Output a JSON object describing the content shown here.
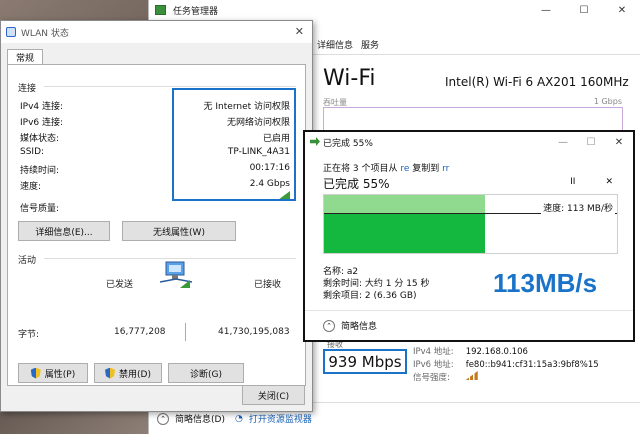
{
  "task_manager": {
    "title": "任务管理器",
    "window_controls": [
      "—",
      "☐",
      "✕"
    ],
    "tabs": [
      "详细信息",
      "服务"
    ],
    "wifi_title": "Wi-Fi",
    "adapter": "Intel(R) Wi-Fi 6 AX201 160MHz",
    "throughput_label": "吞吐量",
    "throughput_max": "1 Gbps",
    "receive_label": "接收",
    "receive_value": "939 Mbps",
    "ipv4_label": "IPv4 地址:",
    "ipv4_value": "192.168.0.106",
    "ipv6_label": "IPv6 地址:",
    "ipv6_value": "fe80::b941:cf31:15a3:9bf8%15",
    "signal_label": "信号强度:",
    "footer_less": "简略信息(D)",
    "footer_link": "打开资源监视器"
  },
  "wlan": {
    "title": "WLAN 状态",
    "close": "✕",
    "tab": "常规",
    "section_connection": "连接",
    "rows": [
      {
        "label": "IPv4 连接:",
        "value": "无 Internet 访问权限"
      },
      {
        "label": "IPv6 连接:",
        "value": "无网络访问权限"
      },
      {
        "label": "媒体状态:",
        "value": "已启用"
      },
      {
        "label": "SSID:",
        "value": "TP-LINK_4A31"
      },
      {
        "label": "持续时间:",
        "value": "00:17:16"
      },
      {
        "label": "速度:",
        "value": "2.4 Gbps"
      }
    ],
    "signal_label": "信号质量:",
    "details_button": "详细信息(E)...",
    "wireless_button": "无线属性(W)",
    "section_activity": "活动",
    "sent_label": "已发送",
    "received_label": "已接收",
    "bytes_label": "字节:",
    "bytes_sent": "16,777,208",
    "bytes_received": "41,730,195,083",
    "properties_button": "属性(P)",
    "disable_button": "禁用(D)",
    "diagnose_button": "诊断(G)",
    "close_button": "关闭(C)"
  },
  "copy_dialog": {
    "title": "已完成 55%",
    "controls": [
      "—",
      "☐",
      "✕"
    ],
    "subtitle_pre": "正在将 3 个项目从 ",
    "source": "re",
    "subtitle_mid": " 复制到 ",
    "dest": "rr",
    "progress_label": "已完成 55%",
    "progress": 0.55,
    "pause": "II",
    "cancel": "✕",
    "speed_label": "速度: 113 MB/秒",
    "name_line": "名称: a2",
    "time_line": "剩余时间: 大约 1 分 15 秒",
    "items_line": "剩余项目: 2 (6.36 GB)",
    "big_speed": "113MB/s",
    "less_info": "简略信息"
  }
}
